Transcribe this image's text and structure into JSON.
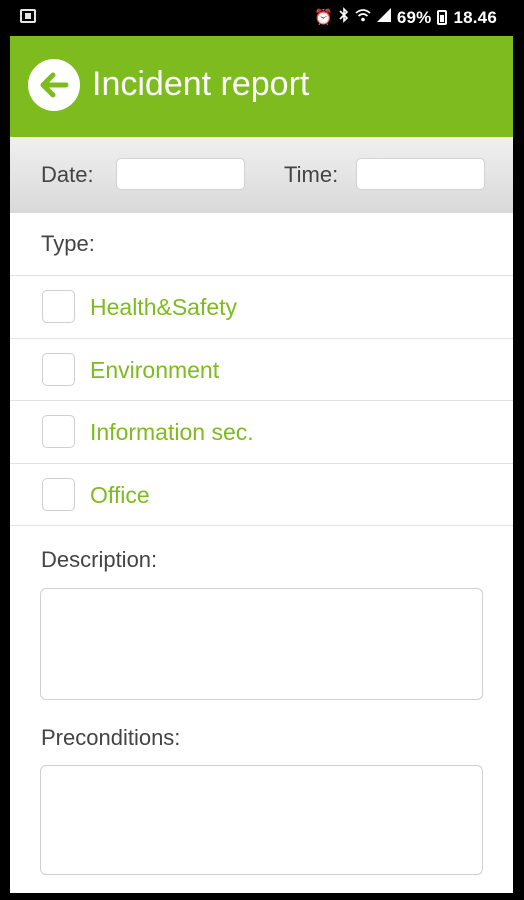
{
  "status_bar": {
    "battery": "69%",
    "time": "18.46",
    "icons": [
      "notification-icon",
      "alarm-icon",
      "bluetooth-icon",
      "wifi-icon",
      "signal-icon",
      "battery-icon"
    ]
  },
  "header": {
    "title": "Incident report",
    "back_icon": "arrow-left-icon",
    "color": "#7dbb1e"
  },
  "form": {
    "date_label": "Date:",
    "date_value": "",
    "time_label": "Time:",
    "time_value": "",
    "type_label": "Type:",
    "types": [
      {
        "label": "Health&Safety",
        "checked": false
      },
      {
        "label": "Environment",
        "checked": false
      },
      {
        "label": "Information sec.",
        "checked": false
      },
      {
        "label": "Office",
        "checked": false
      }
    ],
    "description_label": "Description:",
    "description_value": "",
    "preconditions_label": "Preconditions:",
    "preconditions_value": ""
  }
}
